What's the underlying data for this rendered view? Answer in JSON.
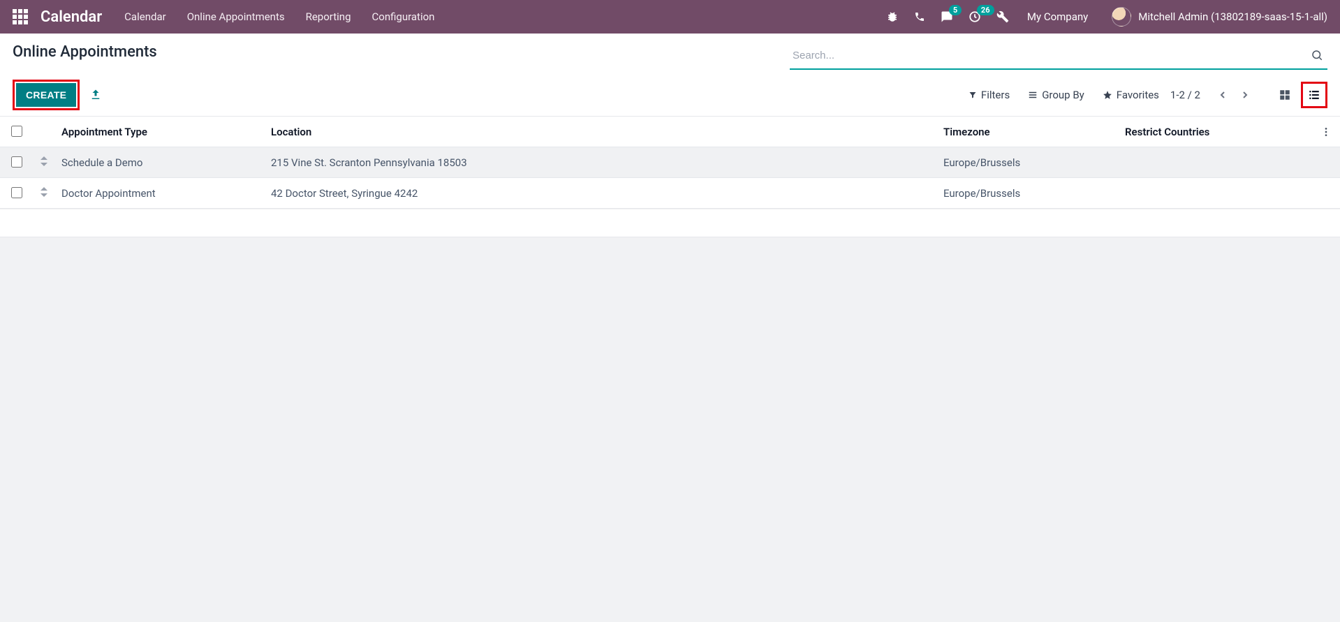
{
  "topnav": {
    "brand": "Calendar",
    "links": [
      "Calendar",
      "Online Appointments",
      "Reporting",
      "Configuration"
    ],
    "messages_badge": "5",
    "activities_badge": "26",
    "company": "My Company",
    "user": "Mitchell Admin (13802189-saas-15-1-all)"
  },
  "control": {
    "breadcrumb": "Online Appointments",
    "search_placeholder": "Search...",
    "create_label": "CREATE",
    "filters_label": "Filters",
    "groupby_label": "Group By",
    "favorites_label": "Favorites",
    "pager": "1-2 / 2"
  },
  "table": {
    "headers": {
      "appointment_type": "Appointment Type",
      "location": "Location",
      "timezone": "Timezone",
      "restrict": "Restrict Countries"
    },
    "rows": [
      {
        "type": "Schedule a Demo",
        "location": "215 Vine St. Scranton Pennsylvania 18503",
        "timezone": "Europe/Brussels",
        "restrict": ""
      },
      {
        "type": "Doctor Appointment",
        "location": "42 Doctor Street, Syringue 4242",
        "timezone": "Europe/Brussels",
        "restrict": ""
      }
    ]
  }
}
